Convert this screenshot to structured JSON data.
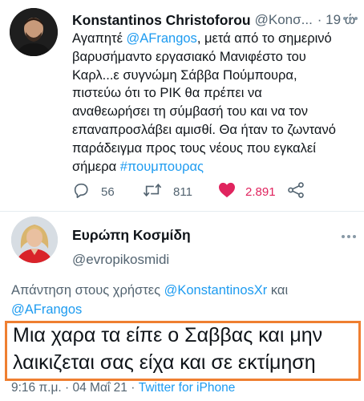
{
  "tweet1": {
    "author_name": "Konstantinos Christoforou",
    "handle": "@Konσ...",
    "time": "· 19 ώ",
    "more_icon": "more-horizontal-icon",
    "text_lines": [
      [
        "Αγαπητέ ",
        "@AFrangos",
        ", μετά από το σημερινό"
      ],
      [
        "βαρυσήμαντο εργασιακό Μανιφέστο του"
      ],
      [
        "Καρλ...ε συγνώμη Σάββα Πούμπουρα,"
      ],
      [
        "πιστεύω ότι το ΡΙΚ θα πρέπει να"
      ],
      [
        "αναθεωρήσει τη σύμβασή του και να τον"
      ],
      [
        "επαναπροσλάβει αμισθί. Θα ήταν το ζωντανό"
      ],
      [
        "παράδειγμα προς τους νέους που εγκαλεί"
      ],
      [
        "σήμερα ",
        "#πουμπουρας"
      ]
    ],
    "actions": {
      "reply_count": "56",
      "retweet_count": "811",
      "like_count": "2.891",
      "like_color": "#e0245e",
      "icons": [
        "reply-icon",
        "retweet-icon",
        "heart-icon",
        "share-icon"
      ]
    }
  },
  "tweet2": {
    "author_name": "Ευρώπη Κοσμίδη",
    "handle": "@evropikosmidi",
    "more_icon": "more-horizontal-icon",
    "reply_prefix": "Απάντηση στους χρήστες ",
    "reply_mention1": "@KonstantinosXr",
    "reply_conjunction": " και",
    "reply_mention2": "@AFrangos",
    "text_lines": [
      "Μια χαρα τα είπε ο Σαββας και μην",
      "λαικιζεται σας είχα και σε εκτίμηση"
    ],
    "time": "9:16 π.μ.",
    "separator": " · ",
    "date": "04 Μαΐ 21",
    "source": "Twitter for iPhone",
    "highlight_color": "#ef7f31"
  },
  "colors": {
    "link": "#1d9bf0",
    "secondary_text": "#536471",
    "primary_text": "#0f1419"
  }
}
